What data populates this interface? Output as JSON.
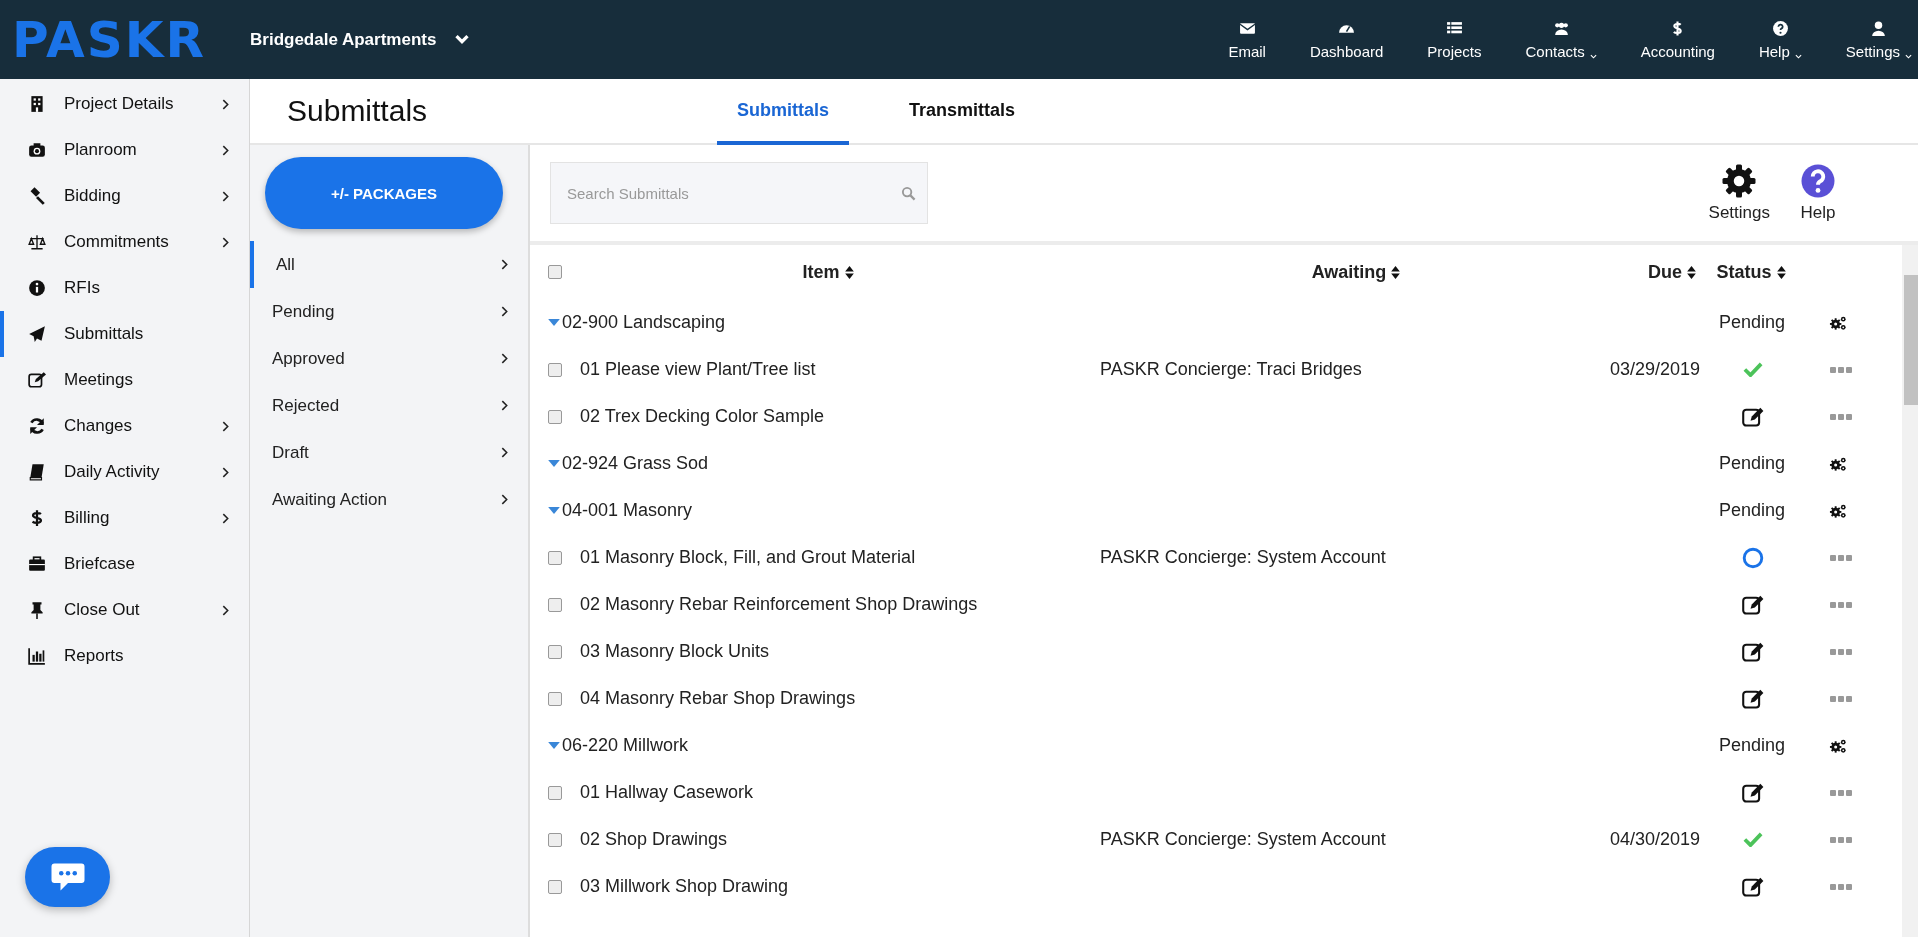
{
  "brand": {
    "logo": "PASKR",
    "project": "Bridgedale Apartments"
  },
  "nav": [
    {
      "label": "Email",
      "dropdown": false
    },
    {
      "label": "Dashboard",
      "dropdown": false
    },
    {
      "label": "Projects",
      "dropdown": false
    },
    {
      "label": "Contacts",
      "dropdown": true
    },
    {
      "label": "Accounting",
      "dropdown": false
    },
    {
      "label": "Help",
      "dropdown": true
    },
    {
      "label": "Settings",
      "dropdown": true
    }
  ],
  "sidebar": {
    "items": [
      {
        "label": "Project Details",
        "submenu": true,
        "selected": false
      },
      {
        "label": "Planroom",
        "submenu": true,
        "selected": false
      },
      {
        "label": "Bidding",
        "submenu": true,
        "selected": false
      },
      {
        "label": "Commitments",
        "submenu": true,
        "selected": false
      },
      {
        "label": "RFIs",
        "submenu": false,
        "selected": false
      },
      {
        "label": "Submittals",
        "submenu": false,
        "selected": true
      },
      {
        "label": "Meetings",
        "submenu": false,
        "selected": false
      },
      {
        "label": "Changes",
        "submenu": true,
        "selected": false
      },
      {
        "label": "Daily Activity",
        "submenu": true,
        "selected": false
      },
      {
        "label": "Billing",
        "submenu": true,
        "selected": false
      },
      {
        "label": "Briefcase",
        "submenu": false,
        "selected": false
      },
      {
        "label": "Close Out",
        "submenu": true,
        "selected": false
      },
      {
        "label": "Reports",
        "submenu": false,
        "selected": false
      }
    ]
  },
  "page": {
    "title": "Submittals",
    "tabs": [
      {
        "label": "Submittals",
        "selected": true
      },
      {
        "label": "Transmittals",
        "selected": false
      }
    ]
  },
  "packages_button": "+/- PACKAGES",
  "filters": [
    {
      "label": "All",
      "selected": true
    },
    {
      "label": "Pending",
      "selected": false
    },
    {
      "label": "Approved",
      "selected": false
    },
    {
      "label": "Rejected",
      "selected": false
    },
    {
      "label": "Draft",
      "selected": false
    },
    {
      "label": "Awaiting Action",
      "selected": false
    }
  ],
  "search": {
    "placeholder": "Search Submittals"
  },
  "tools": [
    {
      "label": "Settings"
    },
    {
      "label": "Help"
    }
  ],
  "table": {
    "columns": [
      "Item",
      "Awaiting",
      "Due",
      "Status"
    ],
    "all_checked": false,
    "groups": [
      {
        "name": "02-900 Landscaping",
        "status": "Pending",
        "expanded": true,
        "items": [
          {
            "name": "01 Please view Plant/Tree list",
            "awaiting": "PASKR Concierge: Traci Bridges",
            "due": "03/29/2019",
            "kind": "approved",
            "checked": false
          },
          {
            "name": "02 Trex Decking Color Sample",
            "kind": "draft",
            "checked": false
          }
        ]
      },
      {
        "name": "02-924 Grass Sod",
        "status": "Pending",
        "expanded": true
      },
      {
        "name": "04-001 Masonry",
        "status": "Pending",
        "expanded": true,
        "items": [
          {
            "name": "01 Masonry Block, Fill, and Grout Material",
            "awaiting": "PASKR Concierge: System Account",
            "kind": "open",
            "checked": false
          },
          {
            "name": "02 Masonry Rebar Reinforcement Shop Drawings",
            "kind": "draft",
            "checked": false
          },
          {
            "name": "03 Masonry Block Units",
            "kind": "draft",
            "checked": false
          },
          {
            "name": "04 Masonry Rebar Shop Drawings",
            "kind": "draft",
            "checked": false
          }
        ]
      },
      {
        "name": "06-220 Millwork",
        "status": "Pending",
        "expanded": true,
        "items": [
          {
            "name": "01 Hallway Casework",
            "kind": "draft",
            "checked": false
          },
          {
            "name": "02 Shop Drawings",
            "awaiting": "PASKR Concierge: System Account",
            "due": "04/30/2019",
            "kind": "approved",
            "checked": false
          },
          {
            "name": "03 Millwork Shop Drawing",
            "kind": "draft",
            "checked": false
          }
        ]
      }
    ]
  }
}
